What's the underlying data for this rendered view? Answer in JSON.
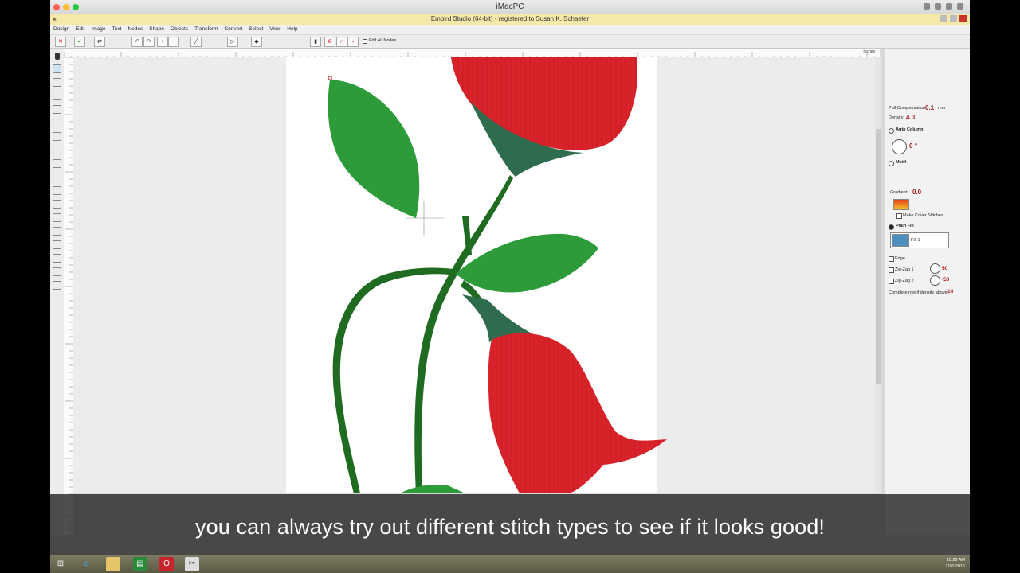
{
  "mac": {
    "title": "iMacPC"
  },
  "app": {
    "title": "Embird Studio (64-bit)  - registered to Susan K. Schaefer"
  },
  "menu": [
    "Design",
    "Edit",
    "Image",
    "Text",
    "Nodes",
    "Shape",
    "Objects",
    "Transform",
    "Convert",
    "Select",
    "View",
    "Help"
  ],
  "toolbar": {
    "edit_all_nodes": "Edit All Nodes"
  },
  "ruler": {
    "unit": "inches"
  },
  "panel": {
    "pull_comp_label": "Pull Compensation:",
    "pull_comp_value": "0.1",
    "pull_comp_unit": "mm",
    "density_label": "Density:",
    "density_value": "4.0",
    "auto_column": "Auto Column",
    "angle_value": "0 °",
    "motif": "Motif",
    "gradient_label": "Gradient:",
    "gradient_value": "0.0",
    "make_cover": "Make Cover Stitches",
    "plain_fill": "Plain Fill",
    "fill_select": "Fill 1",
    "edge": "Edge",
    "zigzag1": "Zig-Zag 1",
    "zigzag1_value": "50",
    "zigzag2": "Zig-Zag 2",
    "zigzag2_value": "-50",
    "complete_row": "Complete row if density above:",
    "complete_row_value": "14"
  },
  "subtitle": "you can always try out different stitch types to see if it looks good!",
  "taskbar": {
    "time": "10:29 AM",
    "date": "2/26/2015"
  },
  "colors": {
    "leaf": "#2e9b3a",
    "stem": "#1f6b22",
    "petal": "#d8232a",
    "calyx": "#2f6b4d"
  }
}
